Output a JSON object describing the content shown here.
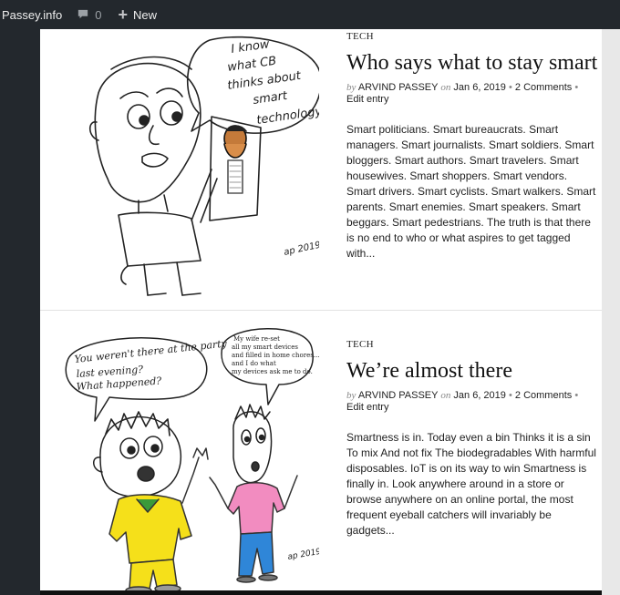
{
  "adminbar": {
    "site_name": "Passey.info",
    "comments_count": "0",
    "new_label": "New"
  },
  "posts": [
    {
      "category": "TECH",
      "title": "Who says what to stay smart",
      "by": "by",
      "author": "ARVIND PASSEY",
      "on": "on",
      "date": "Jan 6, 2019",
      "comments": "2 Comments",
      "edit": "Edit entry",
      "excerpt": "Smart politicians. Smart bureaucrats. Smart managers. Smart journalists. Smart soldiers. Smart bloggers. Smart authors. Smart travelers. Smart housewives. Smart shoppers. Smart vendors. Smart drivers. Smart cyclists. Smart walkers. Smart parents. Smart enemies. Smart speakers. Smart beggars. Smart pedestrians. The truth is that there is no end to who or what aspires to get tagged with...",
      "bubble_text": [
        "I know",
        "what CB",
        "thinks about",
        "smart",
        "technology"
      ],
      "signature": "ap 2019"
    },
    {
      "category": "TECH",
      "title": "We’re almost there",
      "by": "by",
      "author": "ARVIND PASSEY",
      "on": "on",
      "date": "Jan 6, 2019",
      "comments": "2 Comments",
      "edit": "Edit entry",
      "excerpt": "Smartness is in. Today even a bin Thinks it is a sin To mix And not fix The biodegradables With harmful disposables. IoT is on its way to win Smartness is finally in. Look anywhere around in a store or browse anywhere on an online portal, the most frequent eyeball catchers will invariably be gadgets...",
      "bubble_left": [
        "You weren't there at the party",
        "last evening?",
        "What happened?"
      ],
      "bubble_right": [
        "My wife re-set",
        "all my smart devices",
        "and filled in home chores...",
        "and I do what",
        "my devices ask me to do."
      ],
      "signature": "ap 2019"
    }
  ]
}
